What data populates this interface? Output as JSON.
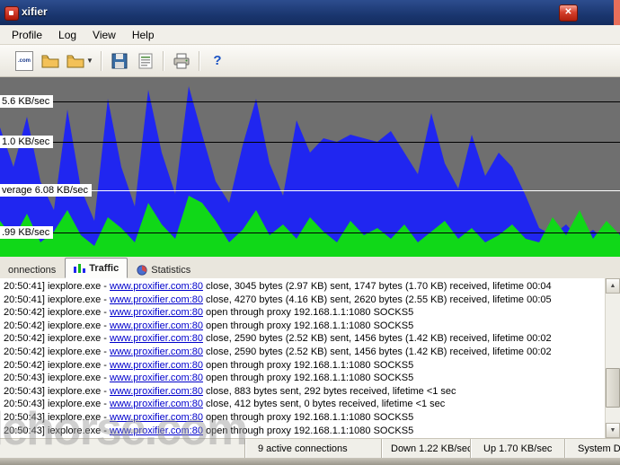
{
  "window": {
    "title": "xifier",
    "close_label": "✕"
  },
  "menu": {
    "items": [
      "Profile",
      "Log",
      "View",
      "Help"
    ]
  },
  "toolbar": {
    "rules_glyph": ".com",
    "help_glyph": "?",
    "dropdown_glyph": "▼"
  },
  "graph": {
    "background": "#6f6f6f",
    "gridlines": [
      {
        "offset": 27,
        "color": "#000000"
      },
      {
        "offset": 72,
        "color": "#000000"
      },
      {
        "offset": 126,
        "color": "#ffffff"
      },
      {
        "offset": 173,
        "color": "#000000"
      }
    ],
    "labels": [
      {
        "text": "5.6 KB/sec",
        "offset": 27
      },
      {
        "text": "1.0 KB/sec",
        "offset": 72
      },
      {
        "text": "verage 6.08 KB/sec",
        "offset": 126
      },
      {
        "text": ".99 KB/sec",
        "offset": 173
      }
    ],
    "series": {
      "blue": {
        "color": "#2026f0",
        "values": [
          72,
          50,
          78,
          42,
          26,
          82,
          38,
          20,
          88,
          50,
          28,
          93,
          58,
          35,
          95,
          68,
          42,
          30,
          62,
          88,
          52,
          34,
          76,
          58,
          66,
          64,
          68,
          66,
          64,
          70,
          58,
          46,
          80,
          52,
          38,
          68,
          45,
          58,
          50,
          34,
          16,
          12,
          18,
          10,
          15,
          8,
          13
        ]
      },
      "green": {
        "color": "#10d818",
        "values": [
          20,
          10,
          24,
          8,
          14,
          26,
          12,
          6,
          22,
          16,
          8,
          30,
          18,
          10,
          34,
          30,
          20,
          8,
          15,
          26,
          12,
          18,
          10,
          22,
          14,
          8,
          20,
          12,
          16,
          10,
          18,
          8,
          14,
          20,
          10,
          16,
          8,
          12,
          18,
          10,
          8,
          22,
          12,
          26,
          10,
          20,
          12
        ]
      }
    }
  },
  "tabs": [
    {
      "label": "onnections",
      "active": false
    },
    {
      "label": "Traffic",
      "active": true
    },
    {
      "label": "Statistics",
      "active": false
    }
  ],
  "log": {
    "link": "www.proxifier.com:80",
    "lines": [
      {
        "time": "20:50:41]",
        "app": "iexplore.exe -",
        "link": "www.proxifier.com:80",
        "rest": "close, 3045 bytes (2.97 KB) sent, 1747 bytes (1.70 KB) received, lifetime 00:04"
      },
      {
        "time": "20:50:41]",
        "app": "iexplore.exe -",
        "link": "www.proxifier.com:80",
        "rest": "close, 4270 bytes (4.16 KB) sent, 2620 bytes (2.55 KB) received, lifetime 00:05"
      },
      {
        "time": "20:50:42]",
        "app": "iexplore.exe -",
        "link": "www.proxifier.com:80",
        "rest": "open through proxy 192.168.1.1:1080 SOCKS5"
      },
      {
        "time": "20:50:42]",
        "app": "iexplore.exe -",
        "link": "www.proxifier.com:80",
        "rest": "open through proxy 192.168.1.1:1080 SOCKS5"
      },
      {
        "time": "20:50:42]",
        "app": "iexplore.exe -",
        "link": "www.proxifier.com:80",
        "rest": "close, 2590 bytes (2.52 KB) sent, 1456 bytes (1.42 KB) received, lifetime 00:02"
      },
      {
        "time": "20:50:42]",
        "app": "iexplore.exe -",
        "link": "www.proxifier.com:80",
        "rest": "close, 2590 bytes (2.52 KB) sent, 1456 bytes (1.42 KB) received, lifetime 00:02"
      },
      {
        "time": "20:50:42]",
        "app": "iexplore.exe -",
        "link": "www.proxifier.com:80",
        "rest": "open through proxy 192.168.1.1:1080 SOCKS5"
      },
      {
        "time": "20:50:43]",
        "app": "iexplore.exe -",
        "link": "www.proxifier.com:80",
        "rest": "open through proxy 192.168.1.1:1080 SOCKS5"
      },
      {
        "time": "20:50:43]",
        "app": "iexplore.exe -",
        "link": "www.proxifier.com:80",
        "rest": "close, 883 bytes sent, 292 bytes received, lifetime <1 sec"
      },
      {
        "time": "20:50:43]",
        "app": "iexplore.exe -",
        "link": "www.proxifier.com:80",
        "rest": "close, 412 bytes sent, 0 bytes received, lifetime <1 sec"
      },
      {
        "time": "20:50:43]",
        "app": "iexplore.exe -",
        "link": "www.proxifier.com:80",
        "rest": "open through proxy 192.168.1.1:1080 SOCKS5"
      },
      {
        "time": "20:50:43]",
        "app": "iexplore.exe -",
        "link": "www.proxifier.com:80",
        "rest": "open through proxy 192.168.1.1:1080 SOCKS5"
      }
    ]
  },
  "status": {
    "connections": "9 active connections",
    "down": "Down 1.22 KB/sec",
    "up": "Up 1.70 KB/sec",
    "system": "System D"
  },
  "watermark": "filehorse.com",
  "colors": {
    "link": "#0000cc",
    "titlebar": "#1a366f",
    "close_red": "#b01f0c"
  }
}
